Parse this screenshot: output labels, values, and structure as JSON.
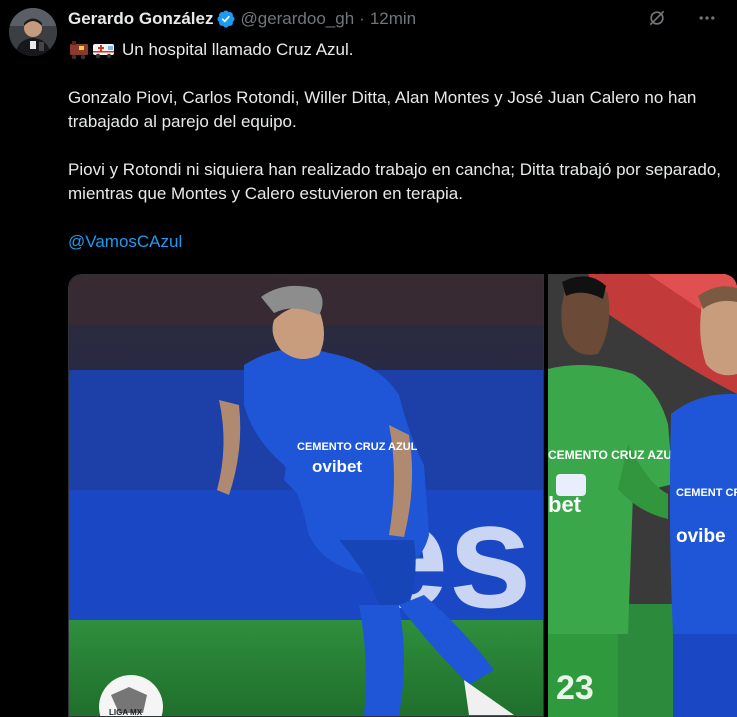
{
  "tweet": {
    "author_name": "Gerardo González",
    "handle": "@gerardoo_gh",
    "separator": "·",
    "time": "12min",
    "line1": "Un hospital llamado Cruz Azul.",
    "paragraph1": "Gonzalo Piovi, Carlos Rotondi, Willer Ditta, Alan Montes y José Juan Calero no han trabajado al parejo del equipo.",
    "paragraph2": "Piovi y Rotondi ni siquiera han realizado trabajo en cancha; Ditta trabajó por separado, mientras que Montes y Calero estuvieron en terapia.",
    "mention": "@VamosCAzul"
  },
  "icons": {
    "verified": "verified-badge-icon",
    "grok": "grok-icon",
    "more": "more-icon",
    "emoji": [
      "train-emoji",
      "ambulance-emoji"
    ]
  },
  "photos": {
    "jersey_text_1": "CEMENTO CRUZ AZUL",
    "jersey_sponsor_1": "ovibet",
    "banner_text": "es",
    "goalkeeper_number": "23",
    "jersey_text_2": "CEMENT CRUZ AZ",
    "jersey_sponsor_2": "ovibe",
    "goalkeeper_jersey_text": "CEMENTO CRUZ AZUL",
    "goalkeeper_sponsor": "bet",
    "ball_text": "LIGA MX"
  },
  "colors": {
    "background": "#000000",
    "text": "#e7e9ea",
    "muted": "#71767b",
    "link": "#1d9bf0",
    "verified": "#1d9bf0",
    "jersey_blue": "#1f56d8",
    "goalkeeper_green": "#3aa84a"
  }
}
